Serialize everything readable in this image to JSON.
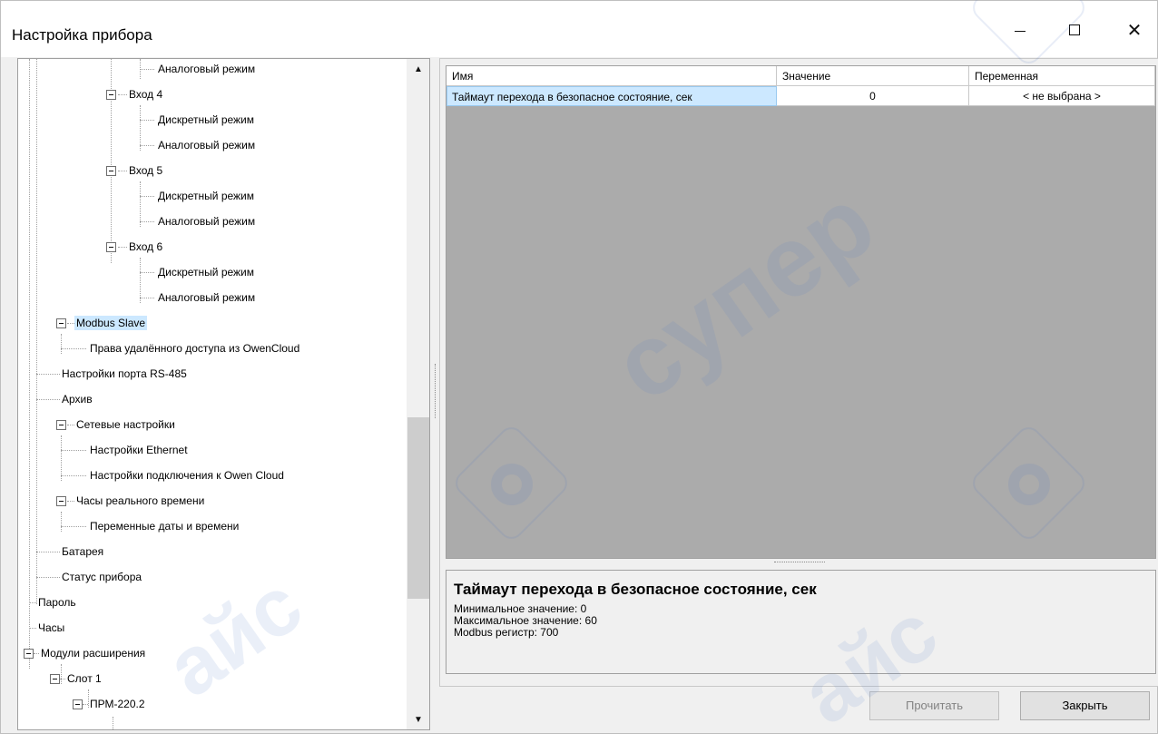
{
  "window": {
    "title": "Настройка прибора",
    "minimize_icon": "minimize-icon",
    "maximize_icon": "maximize-icon",
    "close_glyph": "✕"
  },
  "tree": {
    "nodes": [
      {
        "label": "Аналоговый режим"
      },
      {
        "label": "Вход 4"
      },
      {
        "label": "Дискретный режим"
      },
      {
        "label": "Аналоговый режим"
      },
      {
        "label": "Вход 5"
      },
      {
        "label": "Дискретный режим"
      },
      {
        "label": "Аналоговый режим"
      },
      {
        "label": "Вход 6"
      },
      {
        "label": "Дискретный режим"
      },
      {
        "label": "Аналоговый режим"
      },
      {
        "label": "Modbus Slave",
        "selected": true
      },
      {
        "label": "Права удалённого доступа из OwenCloud"
      },
      {
        "label": "Настройки порта RS-485"
      },
      {
        "label": "Архив"
      },
      {
        "label": "Сетевые настройки"
      },
      {
        "label": "Настройки Ethernet"
      },
      {
        "label": "Настройки подключения к Owen Cloud"
      },
      {
        "label": "Часы реального времени"
      },
      {
        "label": "Переменные даты и времени"
      },
      {
        "label": "Батарея"
      },
      {
        "label": "Статус прибора"
      },
      {
        "label": "Пароль"
      },
      {
        "label": "Часы"
      },
      {
        "label": "Модули расширения"
      },
      {
        "label": "Слот 1"
      },
      {
        "label": "ПРМ-220.2"
      }
    ],
    "scroll_up": "▲",
    "scroll_down": "▼"
  },
  "grid": {
    "columns": [
      "Имя",
      "Значение",
      "Переменная"
    ],
    "rows": [
      {
        "name": "Таймаут перехода в безопасное состояние, сек",
        "value": "0",
        "variable": "< не выбрана >"
      }
    ]
  },
  "description": {
    "title": "Таймаут перехода в безопасное состояние, сек",
    "min": "Минимальное значение: 0",
    "max": "Максимальное значение: 60",
    "register": "Modbus регистр: 700"
  },
  "buttons": {
    "read": "Прочитать",
    "close": "Закрыть"
  },
  "watermark": {
    "text": "супер",
    "text2": "айс"
  },
  "colors": {
    "selection": "#cce8ff",
    "window_bg": "#f0f0f0",
    "watermark": "#5a82c8"
  }
}
